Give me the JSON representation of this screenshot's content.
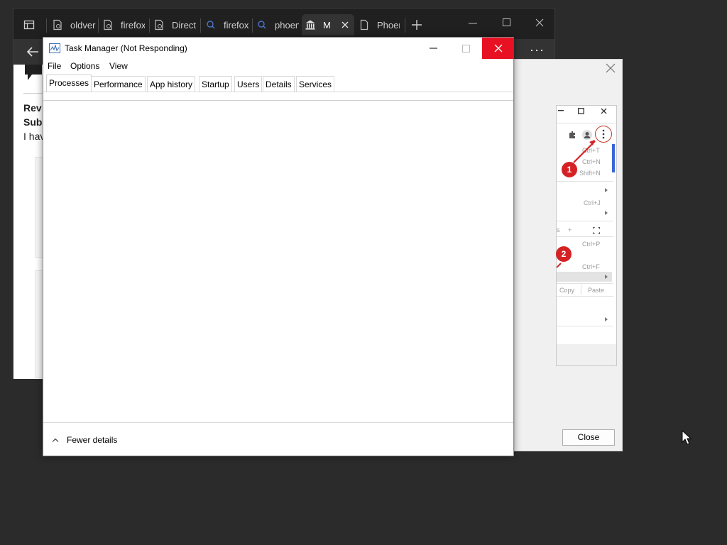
{
  "browser": {
    "tabs": [
      {
        "label": "",
        "icon": "sidebar-panel-icon"
      },
      {
        "label": "oldver",
        "icon": "page-icon"
      },
      {
        "label": "firefox",
        "icon": "page-icon"
      },
      {
        "label": "Direct",
        "icon": "page-icon"
      },
      {
        "label": "firefox",
        "icon": "search-icon"
      },
      {
        "label": "phoen",
        "icon": "search-icon"
      },
      {
        "label": "M",
        "icon": "museum-icon"
      },
      {
        "label": "Phoen",
        "icon": "document-icon"
      }
    ],
    "page_text": {
      "line1": "Rev",
      "line2": "Sub",
      "line3": "I hav"
    },
    "more_label": "···"
  },
  "dialog": {
    "close_label": "Close",
    "mini_menu": {
      "shortcuts": [
        "Ctrl+T",
        "Ctrl+N",
        "Shift+N",
        "Ctrl+J",
        "Ctrl+P",
        "Ctrl+F"
      ],
      "zoom_minus": "s",
      "zoom_plus": "+",
      "copy_label": "Copy",
      "paste_label": "Paste"
    },
    "badges": [
      "1",
      "2"
    ],
    "accent_color": "#d52124"
  },
  "task_manager": {
    "title": "Task Manager (Not Responding)",
    "menu": [
      "File",
      "Options",
      "View"
    ],
    "tabs": [
      "Processes",
      "Performance",
      "App history",
      "Startup",
      "Users",
      "Details",
      "Services"
    ],
    "selected_tab": "Processes",
    "fewer_details": "Fewer details",
    "close_color": "#e81123"
  }
}
